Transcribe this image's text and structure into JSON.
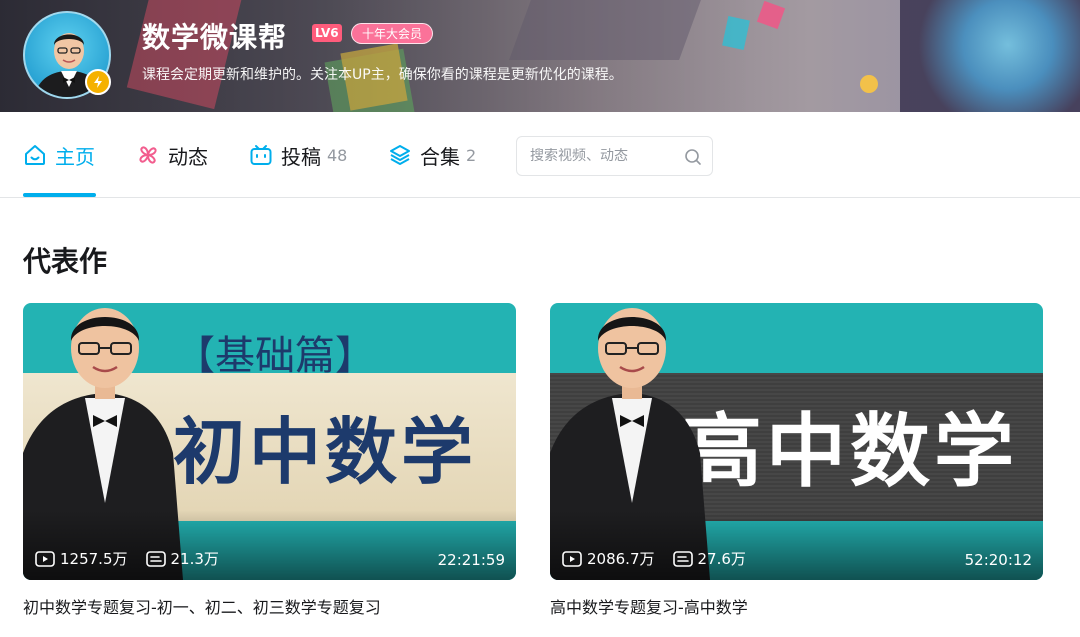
{
  "header": {
    "name": "数学微课帮",
    "level": "LV6",
    "vip_badge": "十年大会员",
    "sign": "课程会定期更新和维护的。关注本UP主，确保你看的课程是更新优化的课程。"
  },
  "nav": {
    "tabs": [
      {
        "label": "主页",
        "count": "",
        "icon": "home-icon"
      },
      {
        "label": "动态",
        "count": "",
        "icon": "pinwheel-icon"
      },
      {
        "label": "投稿",
        "count": "48",
        "icon": "tv-icon"
      },
      {
        "label": "合集",
        "count": "2",
        "icon": "layers-icon"
      }
    ],
    "search_placeholder": "搜索视频、动态"
  },
  "section": {
    "title": "代表作"
  },
  "videos": [
    {
      "thumb_small": "【基础篇】",
      "thumb_big": "初中数学",
      "plays": "1257.5万",
      "danmaku": "21.3万",
      "duration": "22:21:59",
      "title": "初中数学专题复习-初一、初二、初三数学专题复习"
    },
    {
      "thumb_small": "",
      "thumb_big": "高中数学",
      "plays": "2086.7万",
      "danmaku": "27.6万",
      "duration": "52:20:12",
      "title": "高中数学专题复习-高中数学"
    }
  ],
  "colors": {
    "accent": "#00aeec",
    "pink": "#fb7299",
    "thumb_teal": "#23b3b3",
    "navy_text": "#1d3a6c"
  }
}
